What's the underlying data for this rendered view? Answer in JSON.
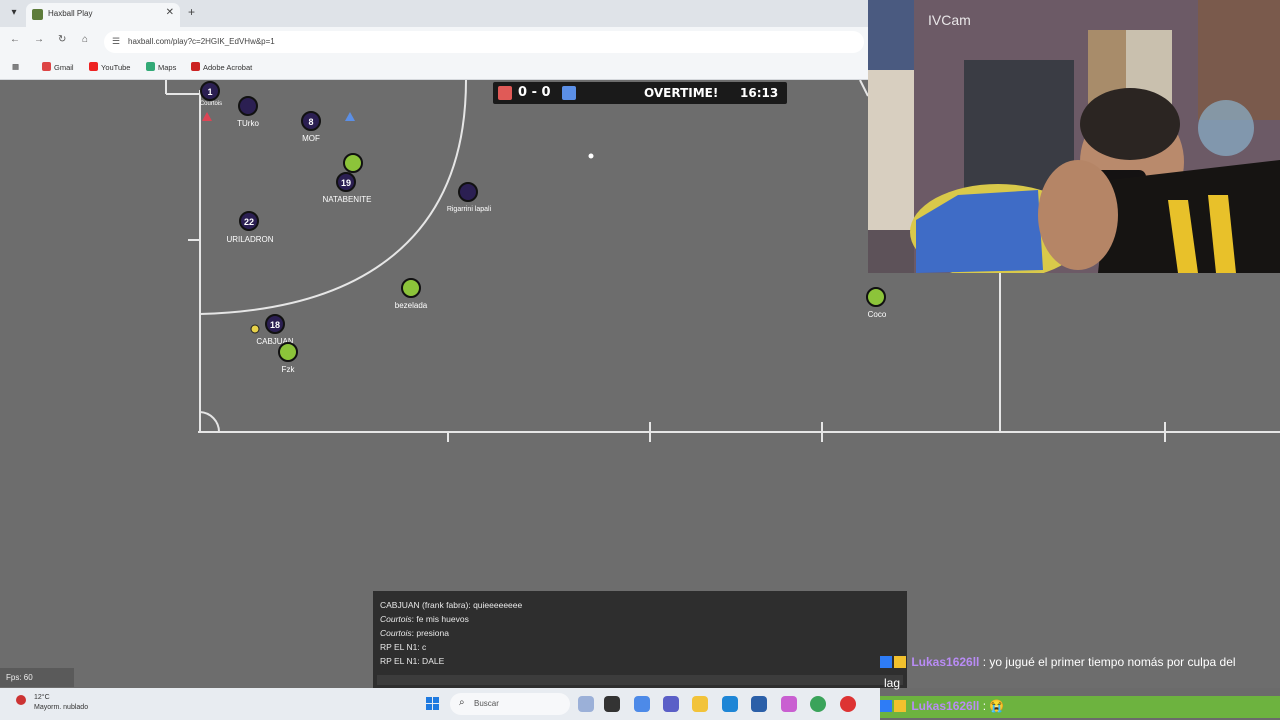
{
  "browser": {
    "tab_title": "Haxball Play",
    "url": "haxball.com/play?c=2HGIK_EdVHw&p=1",
    "bookmarks": [
      "Gmail",
      "YouTube",
      "Maps",
      "Adobe Acrobat"
    ]
  },
  "scoreboard": {
    "score": "0 - 0",
    "status": "OVERTIME!",
    "time": "16:13",
    "red_color": "#e05a57",
    "blue_color": "#5b8fe6"
  },
  "players": {
    "courtois_num": "1",
    "courtois_name": "Courtois",
    "turko_name": "TUrko",
    "mof_num": "8",
    "mof_name": "MOF",
    "natabenite_num": "19",
    "natabenite_name": "NATABENITE",
    "rigarrini_name": "Rigarrini lapali",
    "uriladron_num": "22",
    "uriladron_name": "URILADRON",
    "cabjuan_num": "18",
    "cabjuan_name": "CABJUAN",
    "bezelada_name": "bezelada",
    "fzk_name": "Fzk",
    "coco_name": "Coco"
  },
  "fps": "Fps: 60",
  "chat": {
    "lines": [
      {
        "author": "CABJUAN (frank fabra)",
        "text": ": quieeeeeeee"
      },
      {
        "author": "Courtois",
        "text": ": fe mis huevos"
      },
      {
        "author": "Courtois",
        "text": ": presiona"
      },
      {
        "author": "RP EL N1",
        "text": ": c"
      },
      {
        "author": "RP EL N1",
        "text": ": DALE"
      }
    ]
  },
  "webcam": {
    "label": "IVCam"
  },
  "stream_chat": {
    "line1_user": "Lukas1626ll",
    "line1_text": ": yo jugué el primer tiempo nomás por culpa del",
    "line1_cont": "lag",
    "line2_user": "Lukas1626ll",
    "line2_text": ":"
  },
  "taskbar": {
    "weather_temp": "12°C",
    "weather_desc": "Mayorm. nublado",
    "search_placeholder": "Buscar"
  }
}
